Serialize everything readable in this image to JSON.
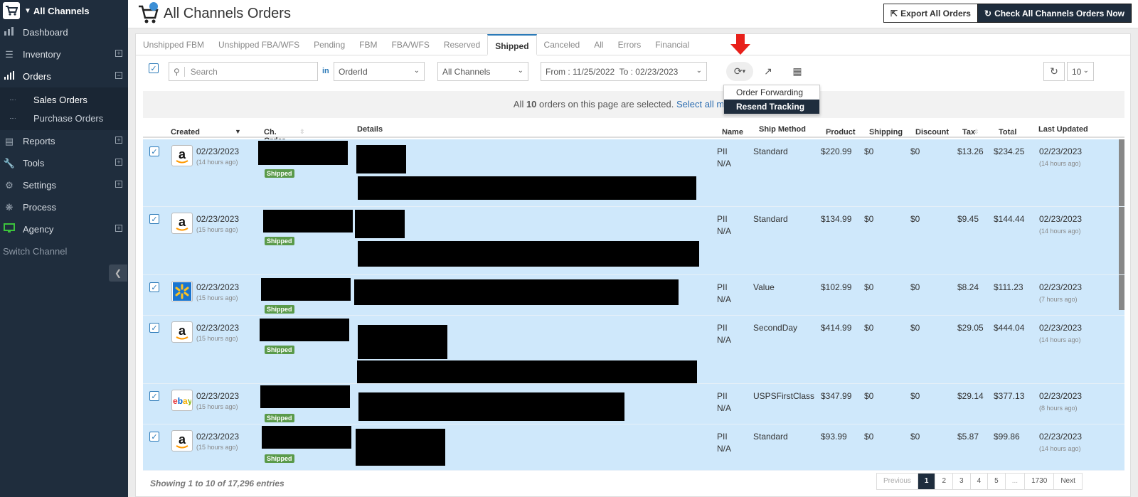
{
  "sidebar": {
    "channel": "All Channels",
    "items": [
      {
        "label": "Dashboard",
        "icon": "chart-bar-icon"
      },
      {
        "label": "Inventory",
        "icon": "bars-icon",
        "expand": "+"
      },
      {
        "label": "Orders",
        "icon": "signal-icon",
        "expand": "−"
      },
      {
        "label": "Reports",
        "icon": "file-icon",
        "expand": "+"
      },
      {
        "label": "Tools",
        "icon": "wrench-icon",
        "expand": "+"
      },
      {
        "label": "Settings",
        "icon": "gear-icon",
        "expand": "+"
      },
      {
        "label": "Process",
        "icon": "bug-icon"
      },
      {
        "label": "Agency",
        "icon": "monitor-icon",
        "expand": "+"
      }
    ],
    "sub_items": [
      "Sales Orders",
      "Purchase Orders"
    ],
    "switch": "Switch Channel"
  },
  "header": {
    "title": "All Channels Orders",
    "export_label": "Export All Orders",
    "check_label": "Check All Channels Orders Now"
  },
  "tabs": [
    "Unshipped FBM",
    "Unshipped FBA/WFS",
    "Pending",
    "FBM",
    "FBA/WFS",
    "Reserved",
    "Shipped",
    "Canceled",
    "All",
    "Errors",
    "Financial"
  ],
  "active_tab": "Shipped",
  "toolbar": {
    "search_placeholder": "Search",
    "in_label": "in",
    "field_select": "OrderId",
    "channel_select": "All Channels",
    "date_range": "From : 11/25/2022  To : 02/23/2023",
    "page_size": "10"
  },
  "dropdown": [
    "Order Forwarding",
    "Resend Tracking"
  ],
  "banner": {
    "prefix": "All ",
    "count": "10",
    "suffix": " orders on this page are selected. ",
    "link": "Select all matching"
  },
  "columns": [
    "Created",
    "Ch. Order ID",
    "Details",
    "Name",
    "Ship Method",
    "Product",
    "Shipping",
    "Discount",
    "Tax",
    "Total",
    "Last Updated"
  ],
  "rows": [
    {
      "channel": "amazon",
      "created": "02/23/2023",
      "ago": "(14 hours ago)",
      "status": "Shipped",
      "name": "PII",
      "name2": "N/A",
      "ship": "Standard",
      "product": "$220.99",
      "shipping": "$0",
      "discount": "$0",
      "tax": "$13.26",
      "total": "$234.25",
      "updated": "02/23/2023",
      "updated_ago": "(14 hours ago)"
    },
    {
      "channel": "amazon",
      "created": "02/23/2023",
      "ago": "(15 hours ago)",
      "status": "Shipped",
      "name": "PII",
      "name2": "N/A",
      "ship": "Standard",
      "product": "$134.99",
      "shipping": "$0",
      "discount": "$0",
      "tax": "$9.45",
      "total": "$144.44",
      "updated": "02/23/2023",
      "updated_ago": "(14 hours ago)"
    },
    {
      "channel": "walmart",
      "created": "02/23/2023",
      "ago": "(15 hours ago)",
      "status": "Shipped",
      "name": "PII",
      "name2": "N/A",
      "ship": "Value",
      "product": "$102.99",
      "shipping": "$0",
      "discount": "$0",
      "tax": "$8.24",
      "total": "$111.23",
      "updated": "02/23/2023",
      "updated_ago": "(7 hours ago)"
    },
    {
      "channel": "amazon",
      "created": "02/23/2023",
      "ago": "(15 hours ago)",
      "status": "Shipped",
      "name": "PII",
      "name2": "N/A",
      "ship": "SecondDay",
      "product": "$414.99",
      "shipping": "$0",
      "discount": "$0",
      "tax": "$29.05",
      "total": "$444.04",
      "updated": "02/23/2023",
      "updated_ago": "(14 hours ago)"
    },
    {
      "channel": "ebay",
      "created": "02/23/2023",
      "ago": "(15 hours ago)",
      "status": "Shipped",
      "name": "PII",
      "name2": "N/A",
      "ship": "USPSFirstClass",
      "product": "$347.99",
      "shipping": "$0",
      "discount": "$0",
      "tax": "$29.14",
      "total": "$377.13",
      "updated": "02/23/2023",
      "updated_ago": "(8 hours ago)"
    },
    {
      "channel": "amazon",
      "created": "02/23/2023",
      "ago": "(15 hours ago)",
      "status": "Shipped",
      "name": "PII",
      "name2": "N/A",
      "ship": "Standard",
      "product": "$93.99",
      "shipping": "$0",
      "discount": "$0",
      "tax": "$5.87",
      "total": "$99.86",
      "updated": "02/23/2023",
      "updated_ago": "(14 hours ago)"
    }
  ],
  "footer": "Showing 1 to 10 of 17,296 entries",
  "pager": [
    "Previous",
    "1",
    "2",
    "3",
    "4",
    "5",
    "...",
    "1730",
    "Next"
  ],
  "colors": {
    "sidebar": "#1f2d3d",
    "row_selected": "#cfe8fb",
    "accent": "#2b7ab8",
    "shipped_badge": "#5a9a4a",
    "arrow": "#e8201a"
  }
}
